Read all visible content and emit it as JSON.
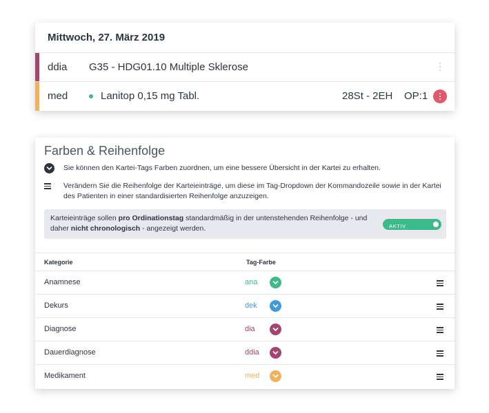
{
  "day_card": {
    "date": "Mittwoch, 27. März 2019",
    "entries": [
      {
        "tag": "ddia",
        "text": "G35 - HDG01.10 Multiple Sklerose",
        "color": "#a5446f"
      },
      {
        "tag": "med",
        "text": "Lanitop 0,15 mg Tabl.",
        "quantity": "28St - 2EH",
        "op": "OP:1",
        "color": "#f0b25a",
        "dot_color": "#3dba8a",
        "menu_color": "#e25868"
      }
    ]
  },
  "settings": {
    "title": "Farben & Reihenfolge",
    "info_colors": "Sie können den Kartei-Tags Farben zuordnen, um eine bessere Übersicht in der Kartei zu erhalten.",
    "info_order_line1": "Verändern Sie die Reihenfolge der Karteieinträge, um diese im Tag-Dropdown der Kommandozeile sowie in der Kartei",
    "info_order_line2": "des Patienten in einer standardisierten Reihenfolge anzuzeigen.",
    "note": {
      "part1": "Karteieinträge sollen ",
      "bold1": "pro Ordinationstag",
      "part2": " standardmäßig in der untenstehenden Reihenfolge - und",
      "part3": "daher ",
      "bold2": "nicht chronologisch",
      "part4": " - angezeigt werden."
    },
    "toggle": {
      "label": "AKTIV",
      "on": true,
      "color": "#3dba8a"
    },
    "table": {
      "col_category": "Kategorie",
      "col_tag_color": "Tag-Farbe",
      "rows": [
        {
          "category": "Anamnese",
          "tag": "ana",
          "color": "#3dba8a"
        },
        {
          "category": "Dekurs",
          "tag": "dek",
          "color": "#3f9bdc"
        },
        {
          "category": "Diagnose",
          "tag": "dia",
          "color": "#a5446f"
        },
        {
          "category": "Dauerdiagnose",
          "tag": "ddia",
          "color": "#a5446f"
        },
        {
          "category": "Medikament",
          "tag": "med",
          "color": "#f0b25a"
        }
      ]
    }
  },
  "icons": {
    "collapse": "chevron-down-icon",
    "order": "menu-icon",
    "drag": "drag-handle-icon",
    "entry_menu": "kebab-menu-icon"
  }
}
